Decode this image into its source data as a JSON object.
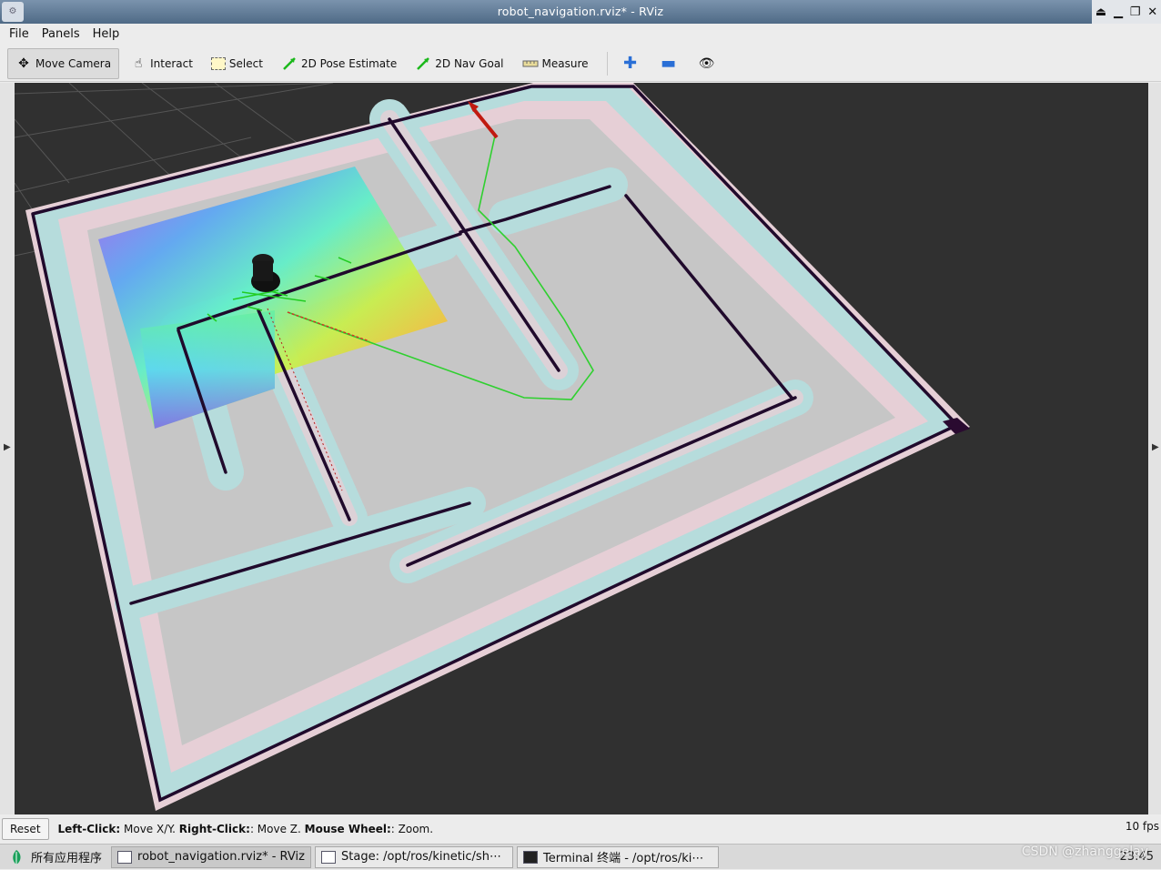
{
  "window": {
    "title": "robot_navigation.rviz* - RViz",
    "app_icon": "rviz-icon",
    "buttons": [
      "⏏",
      "▁",
      "❐",
      "✕"
    ]
  },
  "menu": [
    "File",
    "Panels",
    "Help"
  ],
  "toolbar": {
    "tools": [
      {
        "label": "Move Camera",
        "icon": "move-camera-icon",
        "active": true
      },
      {
        "label": "Interact",
        "icon": "hand-icon"
      },
      {
        "label": "Select",
        "icon": "select-box-icon"
      },
      {
        "label": "2D Pose Estimate",
        "icon": "green-arrow-icon"
      },
      {
        "label": "2D Nav Goal",
        "icon": "green-arrow-icon"
      },
      {
        "label": "Measure",
        "icon": "ruler-icon"
      }
    ],
    "icon_buttons": [
      "plus-icon",
      "minus-icon",
      "eye-icon"
    ]
  },
  "status": {
    "reset_label": "Reset",
    "hint_parts": [
      {
        "bold": "Left-Click:",
        "text": " Move X/Y. "
      },
      {
        "bold": "Right-Click:",
        "text": ": Move Z. "
      },
      {
        "bold": "Mouse Wheel:",
        "text": ": Zoom."
      }
    ],
    "fps": "10 fps"
  },
  "taskbar": {
    "start_label": "所有应用程序",
    "tasks": [
      {
        "label": "robot_navigation.rviz* - RViz",
        "active": true,
        "icon": "rviz-icon"
      },
      {
        "label": "Stage: /opt/ros/kinetic/sh⋯",
        "active": false,
        "icon": "window-icon"
      },
      {
        "label": "Terminal 终端 - /opt/ros/ki⋯",
        "active": false,
        "icon": "terminal-icon"
      }
    ],
    "clock": "23:45"
  },
  "watermark": "CSDN @zhanggelay",
  "colors": {
    "viewport_bg": "#303030",
    "map_floor": "#c6c6c6",
    "inflation_cyan": "#b6dcdc",
    "inflation_pink": "#e6cfd6",
    "wall": "#200a2c",
    "path": "#2fd02f",
    "goal_arrow": "#c01a10"
  }
}
